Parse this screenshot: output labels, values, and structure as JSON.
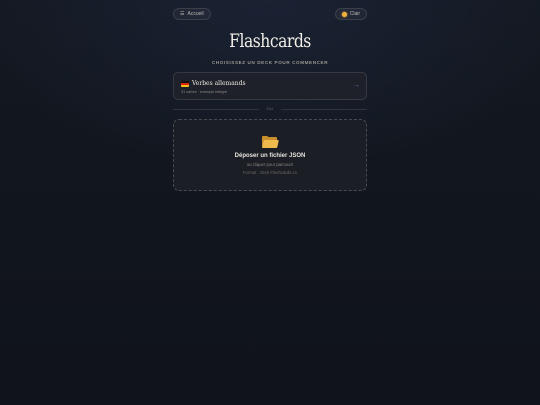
{
  "header": {
    "home_label": "Accueil",
    "home_icon": "menu-icon",
    "theme_label": "Clair",
    "theme_icon": "sun-icon"
  },
  "main": {
    "title": "Flashcards",
    "subtitle": "CHOISISSEZ UN DECK POUR COMMENCER",
    "deck": {
      "name": "Verbes allemands",
      "flag_icon": "germany-flag-icon",
      "meta": "31 cartes · exemple intégré",
      "arrow": "→"
    },
    "separator": "OU",
    "dropzone": {
      "icon": "open-folder-icon",
      "title": "Déposer un fichier JSON",
      "subtitle": "ou cliquer pour parcourir",
      "format": "Format : deck Flashcards v1"
    }
  },
  "colors": {
    "background": "#11151c",
    "accent": "#5d79c9",
    "folder": "#efb94b",
    "theme_dot": "#f2b33d"
  }
}
